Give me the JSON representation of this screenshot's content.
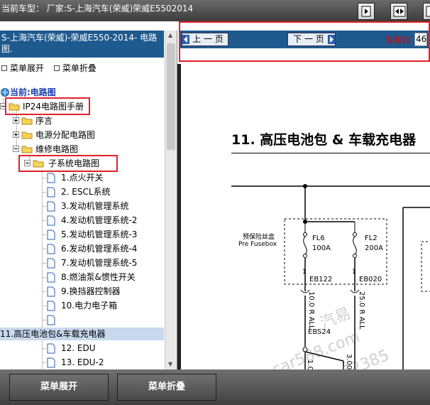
{
  "topbar": {
    "title": "当前车型：  厂家:S-上海汽车(荣威)荣威E5502014"
  },
  "left": {
    "header": "S-上海汽车(荣威)-荣威E550-2014- 电路图.",
    "menu_expand": "菜单展开",
    "menu_collapse": "菜单折叠",
    "tree": [
      {
        "label": "当前:电路图",
        "level": 0
      },
      {
        "label": "IP24电路图手册",
        "level": 0
      },
      {
        "label": "序言",
        "level": 1
      },
      {
        "label": "电源分配电路图",
        "level": 1
      },
      {
        "label": "维修电路图",
        "level": 1
      },
      {
        "label": "子系统电路图",
        "level": 2
      },
      {
        "label": "1.点火开关",
        "level": 3
      },
      {
        "label": "2. ESCL系统",
        "level": 3
      },
      {
        "label": "3.发动机管理系统",
        "level": 3
      },
      {
        "label": "4.发动机管理系统-2",
        "level": 3
      },
      {
        "label": "5.发动机管理系统-3",
        "level": 3
      },
      {
        "label": "6.发动机管理系统-4",
        "level": 3
      },
      {
        "label": "7.发动机管理系统-5",
        "level": 3
      },
      {
        "label": "8.燃油泵&惯性开关",
        "level": 3
      },
      {
        "label": "9.换挡器控制器",
        "level": 3
      },
      {
        "label": "10.电力电子箱",
        "level": 3
      },
      {
        "label": "",
        "level": 3
      },
      {
        "label": "11.高压电池包&车载充电器",
        "level": 3
      },
      {
        "label": "12. EDU",
        "level": 3
      },
      {
        "label": "13. EDU-2",
        "level": 3
      }
    ]
  },
  "nav": {
    "prev": "上 一 页",
    "next": "下 一 页",
    "current_label": "当前为",
    "current_value": "46"
  },
  "doc": {
    "heading": "11. 高压电池包 & 车载充电器",
    "fuse_box_cn": "预保险丝盒",
    "fuse_box_en": "Pre Fusebox",
    "fuse1_name": "FL6",
    "fuse1_rating": "100A",
    "fuse2_name": "FL2",
    "fuse2_rating": "200A",
    "pin1": "1",
    "pin2": "1",
    "conn1": "EB122",
    "conn2": "EB020",
    "wire1": "10.0 R ALL",
    "wire2": "25.0 R ALL",
    "splice": "EBS24",
    "wire3": "1.00",
    "wire4": "3.00",
    "watermark1": "汽易",
    "watermark2": "car588.com",
    "watermark3": "62385"
  },
  "bottom": {
    "expand": "菜单展开",
    "collapse": "菜单折叠"
  }
}
